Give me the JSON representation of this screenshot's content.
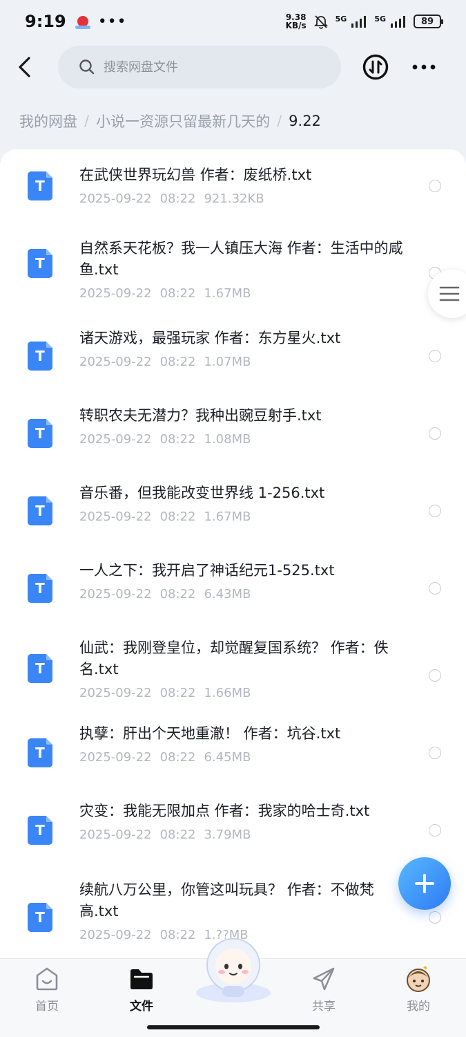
{
  "status_bar": {
    "time": "9:19",
    "more": "•••",
    "net_speed_value": "9.38",
    "net_speed_unit": "KB/s",
    "signal1_label": "5G",
    "signal2_label": "5G",
    "battery": "89"
  },
  "header": {
    "search_placeholder": "搜索网盘文件"
  },
  "breadcrumb": {
    "items": [
      "我的网盘",
      "小说一资源只留最新几天的"
    ],
    "current": "9.22",
    "separator": "/"
  },
  "files": [
    {
      "name": "在武侠世界玩幻兽 作者：废纸桥.txt",
      "date": "2025-09-22",
      "time": "08:22",
      "size": "921.32KB",
      "icon_letter": "T"
    },
    {
      "name": "自然系天花板？我一人镇压大海 作者：生活中的咸鱼.txt",
      "date": "2025-09-22",
      "time": "08:22",
      "size": "1.67MB",
      "icon_letter": "T"
    },
    {
      "name": "诸天游戏，最强玩家 作者：东方星火.txt",
      "date": "2025-09-22",
      "time": "08:22",
      "size": "1.07MB",
      "icon_letter": "T"
    },
    {
      "name": "转职农夫无潜力？我种出豌豆射手.txt",
      "date": "2025-09-22",
      "time": "08:22",
      "size": "1.08MB",
      "icon_letter": "T"
    },
    {
      "name": "音乐番，但我能改变世界线 1-256.txt",
      "date": "2025-09-22",
      "time": "08:22",
      "size": "1.67MB",
      "icon_letter": "T"
    },
    {
      "name": "一人之下：我开启了神话纪元1-525.txt",
      "date": "2025-09-22",
      "time": "08:22",
      "size": "6.43MB",
      "icon_letter": "T"
    },
    {
      "name": "仙武：我刚登皇位，却觉醒复国系统？ 作者：佚名.txt",
      "date": "2025-09-22",
      "time": "08:22",
      "size": "1.66MB",
      "icon_letter": "T"
    },
    {
      "name": "执孽：肝出个天地重澈！ 作者：坑谷.txt",
      "date": "2025-09-22",
      "time": "08:22",
      "size": "6.45MB",
      "icon_letter": "T"
    },
    {
      "name": "灾变：我能无限加点 作者：我家的哈士奇.txt",
      "date": "2025-09-22",
      "time": "08:22",
      "size": "3.79MB",
      "icon_letter": "T"
    },
    {
      "name": "续航八万公里，你管这叫玩具？ 作者：不做梵高.txt",
      "date": "2025-09-22",
      "time": "08:22",
      "size": "1.??MB",
      "icon_letter": "T"
    }
  ],
  "bottom_nav": {
    "home": "首页",
    "files": "文件",
    "share": "共享",
    "mine": "我的",
    "active": "files"
  },
  "colors": {
    "accent": "#3b86f7",
    "fab": "#2f7bf5",
    "background": "#eef1f6"
  }
}
